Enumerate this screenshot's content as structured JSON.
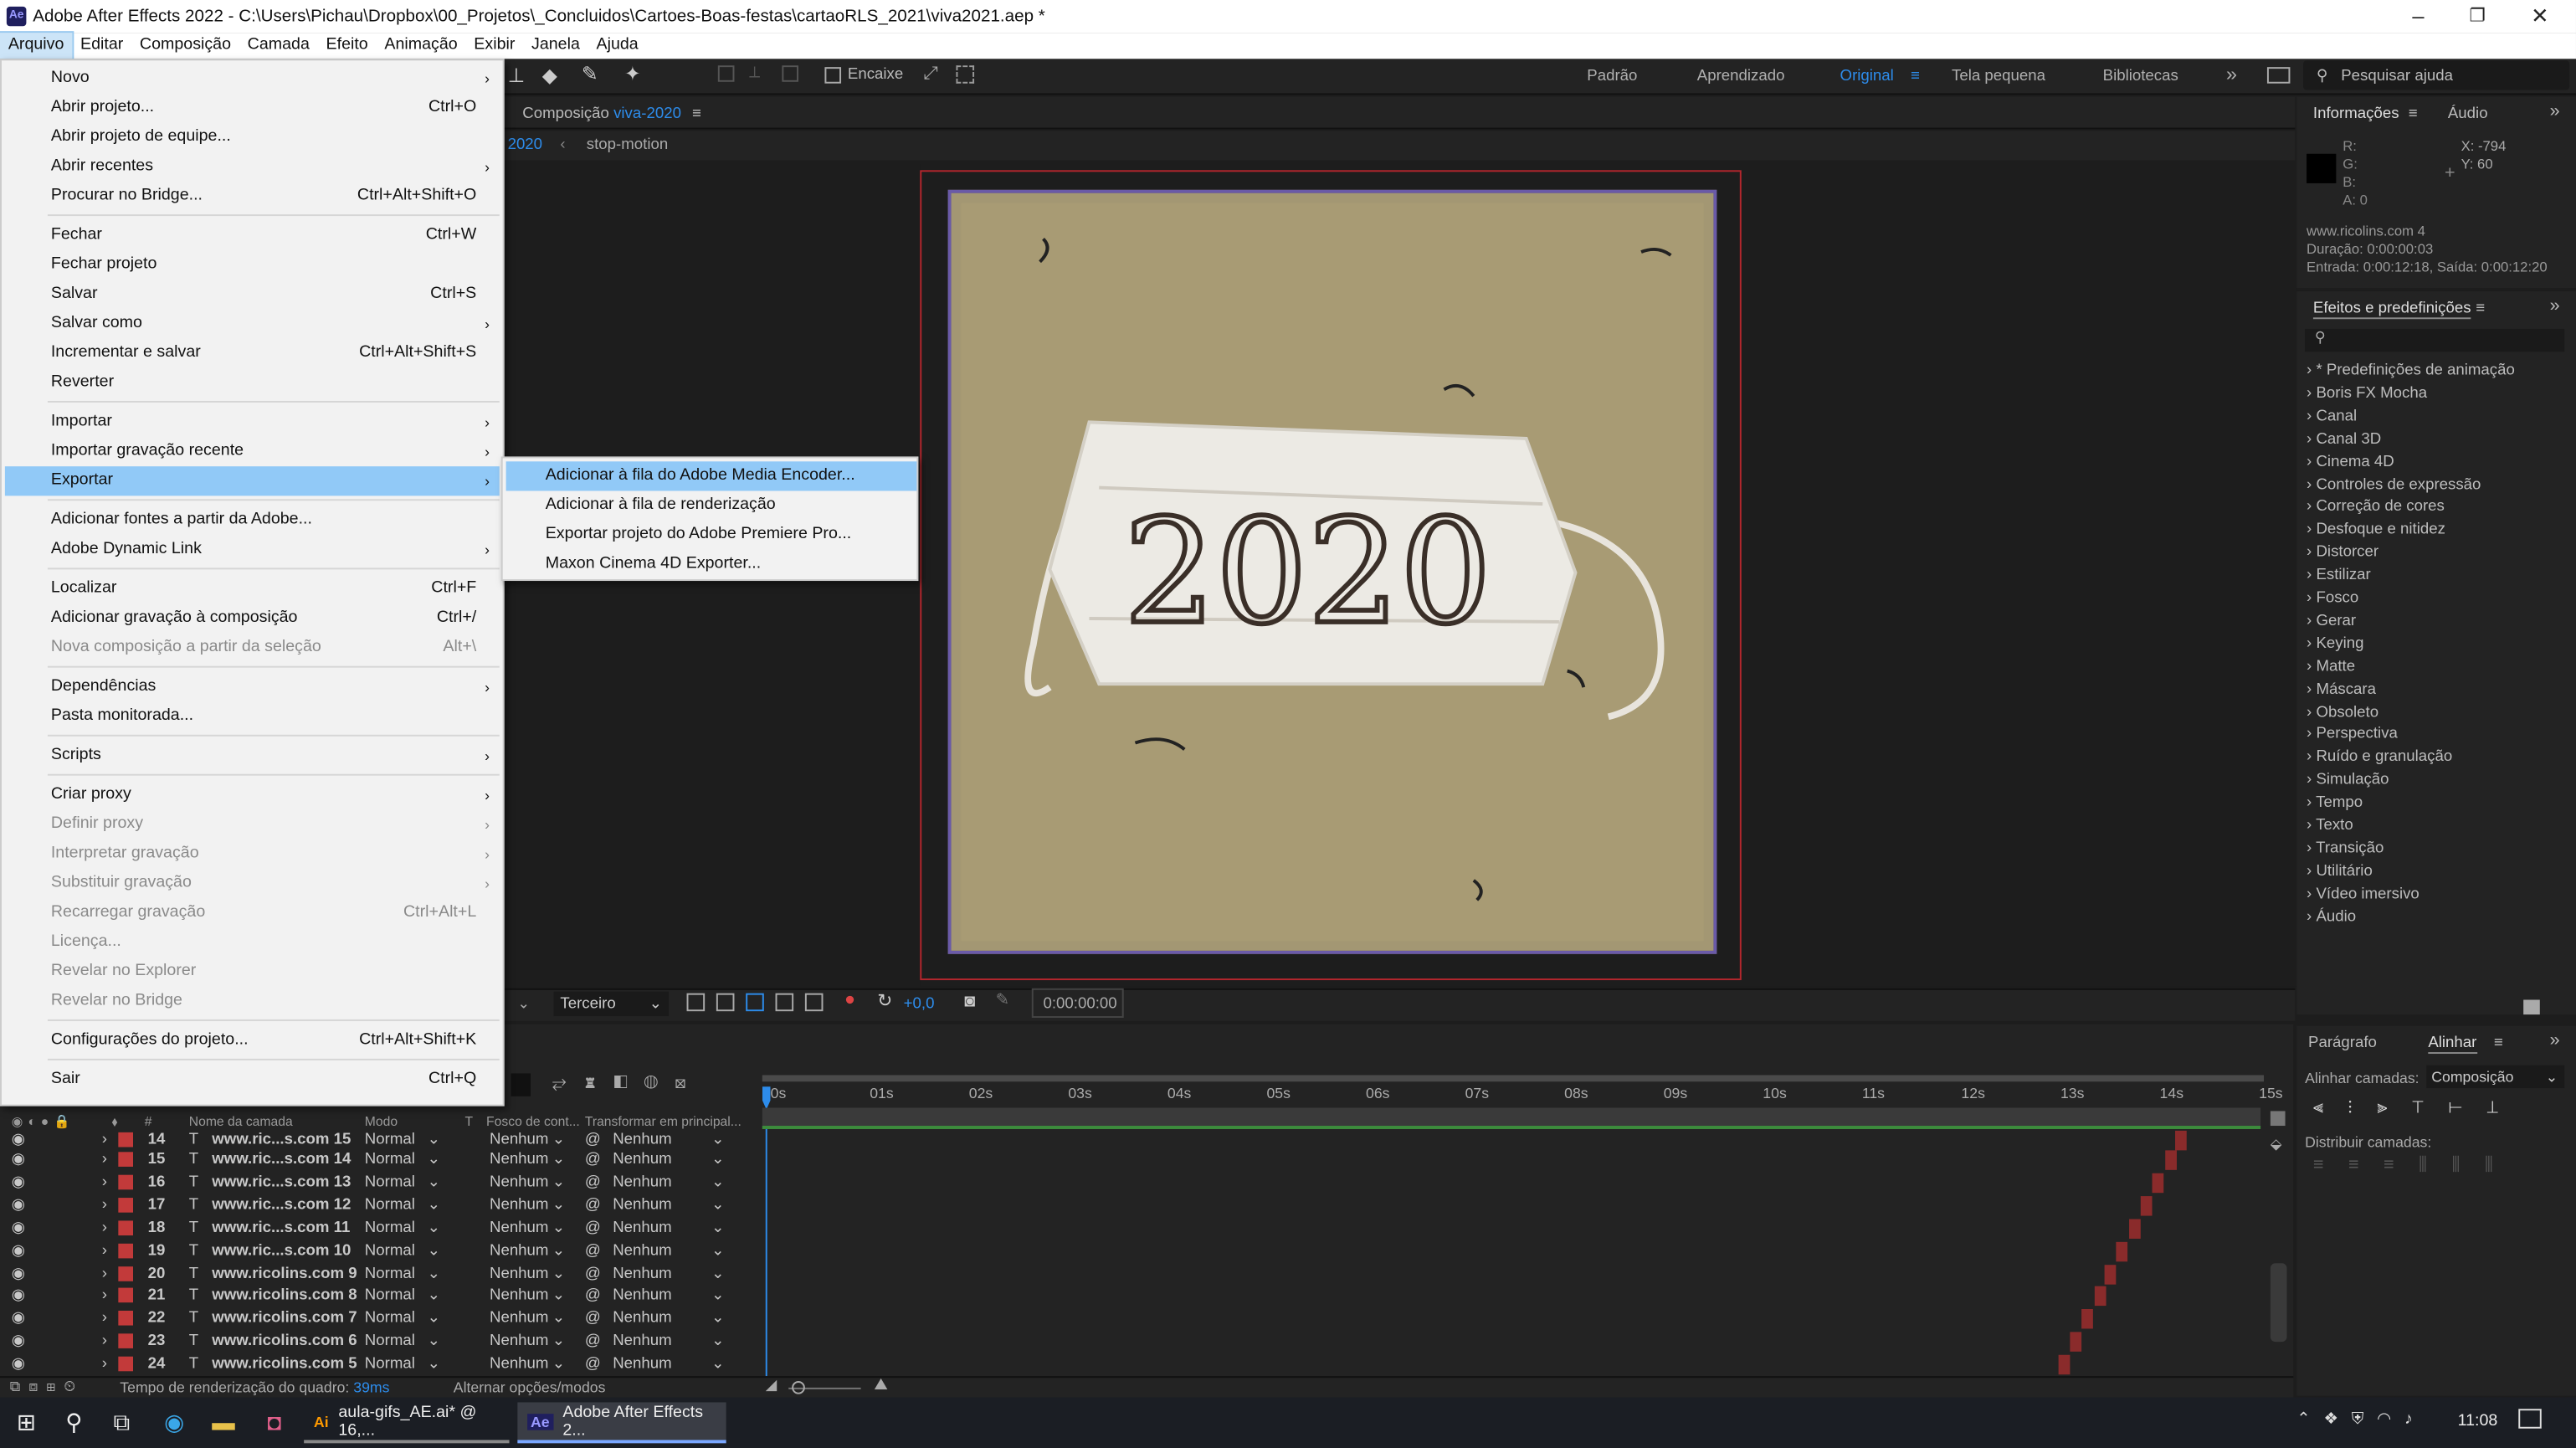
{
  "window": {
    "title": "Adobe After Effects 2022 - C:\\Users\\Pichau\\Dropbox\\00_Projetos\\_Concluidos\\Cartoes-Boas-festas\\cartaoRLS_2021\\viva2021.aep *",
    "logo": "Ae"
  },
  "menubar": [
    "Arquivo",
    "Editar",
    "Composição",
    "Camada",
    "Efeito",
    "Animação",
    "Exibir",
    "Janela",
    "Ajuda"
  ],
  "toolbar": {
    "snap": "Encaixe",
    "workspaces": [
      "Padrão",
      "Aprendizado",
      "Original",
      "Tela pequena",
      "Bibliotecas"
    ],
    "search": "Pesquisar ajuda"
  },
  "file_menu": [
    {
      "label": "Novo",
      "shortcut": "",
      "submenu": true
    },
    {
      "label": "Abrir projeto...",
      "shortcut": "Ctrl+O"
    },
    {
      "label": "Abrir projeto de equipe...",
      "shortcut": ""
    },
    {
      "label": "Abrir recentes",
      "shortcut": "",
      "submenu": true
    },
    {
      "label": "Procurar no Bridge...",
      "shortcut": "Ctrl+Alt+Shift+O"
    },
    {
      "label": "Fechar",
      "shortcut": "Ctrl+W"
    },
    {
      "label": "Fechar projeto",
      "shortcut": ""
    },
    {
      "label": "Salvar",
      "shortcut": "Ctrl+S"
    },
    {
      "label": "Salvar como",
      "shortcut": "",
      "submenu": true
    },
    {
      "label": "Incrementar e salvar",
      "shortcut": "Ctrl+Alt+Shift+S"
    },
    {
      "label": "Reverter",
      "shortcut": ""
    },
    {
      "label": "Importar",
      "shortcut": "",
      "submenu": true
    },
    {
      "label": "Importar gravação recente",
      "shortcut": "",
      "submenu": true
    },
    {
      "label": "Exportar",
      "shortcut": "",
      "submenu": true,
      "highlight": true
    },
    {
      "label": "Adicionar fontes a partir da Adobe...",
      "shortcut": ""
    },
    {
      "label": "Adobe Dynamic Link",
      "shortcut": "",
      "submenu": true
    },
    {
      "label": "Localizar",
      "shortcut": "Ctrl+F"
    },
    {
      "label": "Adicionar gravação à composição",
      "shortcut": "Ctrl+/"
    },
    {
      "label": "Nova composição a partir da seleção",
      "shortcut": "Alt+\\",
      "disabled": true
    },
    {
      "label": "Dependências",
      "shortcut": "",
      "submenu": true
    },
    {
      "label": "Pasta monitorada...",
      "shortcut": ""
    },
    {
      "label": "Scripts",
      "shortcut": "",
      "submenu": true
    },
    {
      "label": "Criar proxy",
      "shortcut": "",
      "submenu": true
    },
    {
      "label": "Definir proxy",
      "shortcut": "",
      "submenu": true,
      "disabled": true
    },
    {
      "label": "Interpretar gravação",
      "shortcut": "",
      "submenu": true,
      "disabled": true
    },
    {
      "label": "Substituir gravação",
      "shortcut": "",
      "submenu": true,
      "disabled": true
    },
    {
      "label": "Recarregar gravação",
      "shortcut": "Ctrl+Alt+L",
      "disabled": true
    },
    {
      "label": "Licença...",
      "shortcut": "",
      "disabled": true
    },
    {
      "label": "Revelar no Explorer",
      "shortcut": "",
      "disabled": true
    },
    {
      "label": "Revelar no Bridge",
      "shortcut": "",
      "disabled": true
    },
    {
      "label": "Configurações do projeto...",
      "shortcut": "Ctrl+Alt+Shift+K"
    },
    {
      "label": "Sair",
      "shortcut": "Ctrl+Q"
    }
  ],
  "export_submenu": [
    "Adicionar à fila do Adobe Media Encoder...",
    "Adicionar à fila de renderização",
    "Exportar projeto do Adobe Premiere Pro...",
    "Maxon Cinema 4D Exporter..."
  ],
  "composition": {
    "label": "Composição",
    "name": "viva-2020",
    "breadcrumb_current": "2020",
    "breadcrumb_child": "stop-motion",
    "mask_text": "2020",
    "camera": "Terceiro",
    "exposure": "+0,0",
    "timecode": "0:00:00:00"
  },
  "info_panel": {
    "tab": "Informações",
    "tab2": "Áudio",
    "r": "R:",
    "g": "G:",
    "b": "B:",
    "a": "A:  0",
    "x": "X: -794",
    "y": "Y:  60",
    "name": "www.ricolins.com 4",
    "duration": "Duração: 0:00:00:03",
    "in_out": "Entrada: 0:00:12:18, Saída: 0:00:12:20"
  },
  "effects_panel": {
    "tab": "Efeitos e predefinições",
    "items": [
      "* Predefinições de animação",
      "Boris FX Mocha",
      "Canal",
      "Canal 3D",
      "Cinema 4D",
      "Controles de expressão",
      "Correção de cores",
      "Desfoque e nitidez",
      "Distorcer",
      "Estilizar",
      "Fosco",
      "Gerar",
      "Keying",
      "Matte",
      "Máscara",
      "Obsoleto",
      "Perspectiva",
      "Ruído e granulação",
      "Simulação",
      "Tempo",
      "Texto",
      "Transição",
      "Utilitário",
      "Vídeo imersivo",
      "Áudio"
    ]
  },
  "align_panel": {
    "tab1": "Parágrafo",
    "tab2": "Alinhar",
    "align_label": "Alinhar camadas:",
    "align_to": "Composição",
    "distribute_label": "Distribuir camadas:"
  },
  "timeline": {
    "headers": {
      "name": "Nome da camada",
      "mode": "Modo",
      "t": "T",
      "focus": "Fosco de cont...",
      "parent": "Transformar em principal..."
    },
    "ticks": [
      "0s",
      "01s",
      "02s",
      "03s",
      "04s",
      "05s",
      "06s",
      "07s",
      "08s",
      "09s",
      "10s",
      "11s",
      "12s",
      "13s",
      "14s",
      "15s"
    ],
    "layers": [
      {
        "num": "14",
        "name": "www.ric...s.com 15",
        "mode": "Normal",
        "matte": "Nenhum",
        "parent": "Nenhum",
        "bar_start": 0.943
      },
      {
        "num": "15",
        "name": "www.ric...s.com 14",
        "mode": "Normal",
        "matte": "Nenhum",
        "parent": "Nenhum",
        "bar_start": 0.936
      },
      {
        "num": "16",
        "name": "www.ric...s.com 13",
        "mode": "Normal",
        "matte": "Nenhum",
        "parent": "Nenhum",
        "bar_start": 0.928
      },
      {
        "num": "17",
        "name": "www.ric...s.com 12",
        "mode": "Normal",
        "matte": "Nenhum",
        "parent": "Nenhum",
        "bar_start": 0.92
      },
      {
        "num": "18",
        "name": "www.ric...s.com 11",
        "mode": "Normal",
        "matte": "Nenhum",
        "parent": "Nenhum",
        "bar_start": 0.912
      },
      {
        "num": "19",
        "name": "www.ric...s.com 10",
        "mode": "Normal",
        "matte": "Nenhum",
        "parent": "Nenhum",
        "bar_start": 0.904
      },
      {
        "num": "20",
        "name": "www.ricolins.com 9",
        "mode": "Normal",
        "matte": "Nenhum",
        "parent": "Nenhum",
        "bar_start": 0.896
      },
      {
        "num": "21",
        "name": "www.ricolins.com 8",
        "mode": "Normal",
        "matte": "Nenhum",
        "parent": "Nenhum",
        "bar_start": 0.889
      },
      {
        "num": "22",
        "name": "www.ricolins.com 7",
        "mode": "Normal",
        "matte": "Nenhum",
        "parent": "Nenhum",
        "bar_start": 0.881
      },
      {
        "num": "23",
        "name": "www.ricolins.com 6",
        "mode": "Normal",
        "matte": "Nenhum",
        "parent": "Nenhum",
        "bar_start": 0.873
      },
      {
        "num": "24",
        "name": "www.ricolins.com 5",
        "mode": "Normal",
        "matte": "Nenhum",
        "parent": "Nenhum",
        "bar_start": 0.865
      }
    ],
    "render_time_label": "Tempo de renderização do quadro:",
    "render_time": "39ms",
    "toggle_modes": "Alternar opções/modos"
  },
  "taskbar": {
    "task1": "aula-gifs_AE.ai* @ 16,...",
    "task2": "Adobe After Effects 2...",
    "clock": "11:08"
  },
  "colors": {
    "accent": "#2d8ceb",
    "layer_label": "#c23a3a",
    "menu_highlight": "#91c9f7"
  }
}
